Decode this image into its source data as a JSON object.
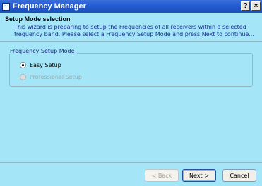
{
  "window": {
    "title": "Frequency Manager",
    "help_label": "?",
    "close_label": "×"
  },
  "header": {
    "title": "Setup Mode selection",
    "description": "This wizard is preparing to setup the Frequencies of all receivers within a selected frequency band. Please select a Frequency Setup Mode and press Next to continue..."
  },
  "group": {
    "label": "Frequency Setup Mode",
    "options": [
      {
        "label": "Easy Setup",
        "selected": true,
        "enabled": true
      },
      {
        "label": "Professional Setup",
        "selected": false,
        "enabled": false
      }
    ]
  },
  "buttons": {
    "back": "< Back",
    "next": "Next >",
    "cancel": "Cancel"
  },
  "colors": {
    "background": "#a4e6f8",
    "titlebar": "#245ed3",
    "description_text": "#1a2f8a"
  }
}
